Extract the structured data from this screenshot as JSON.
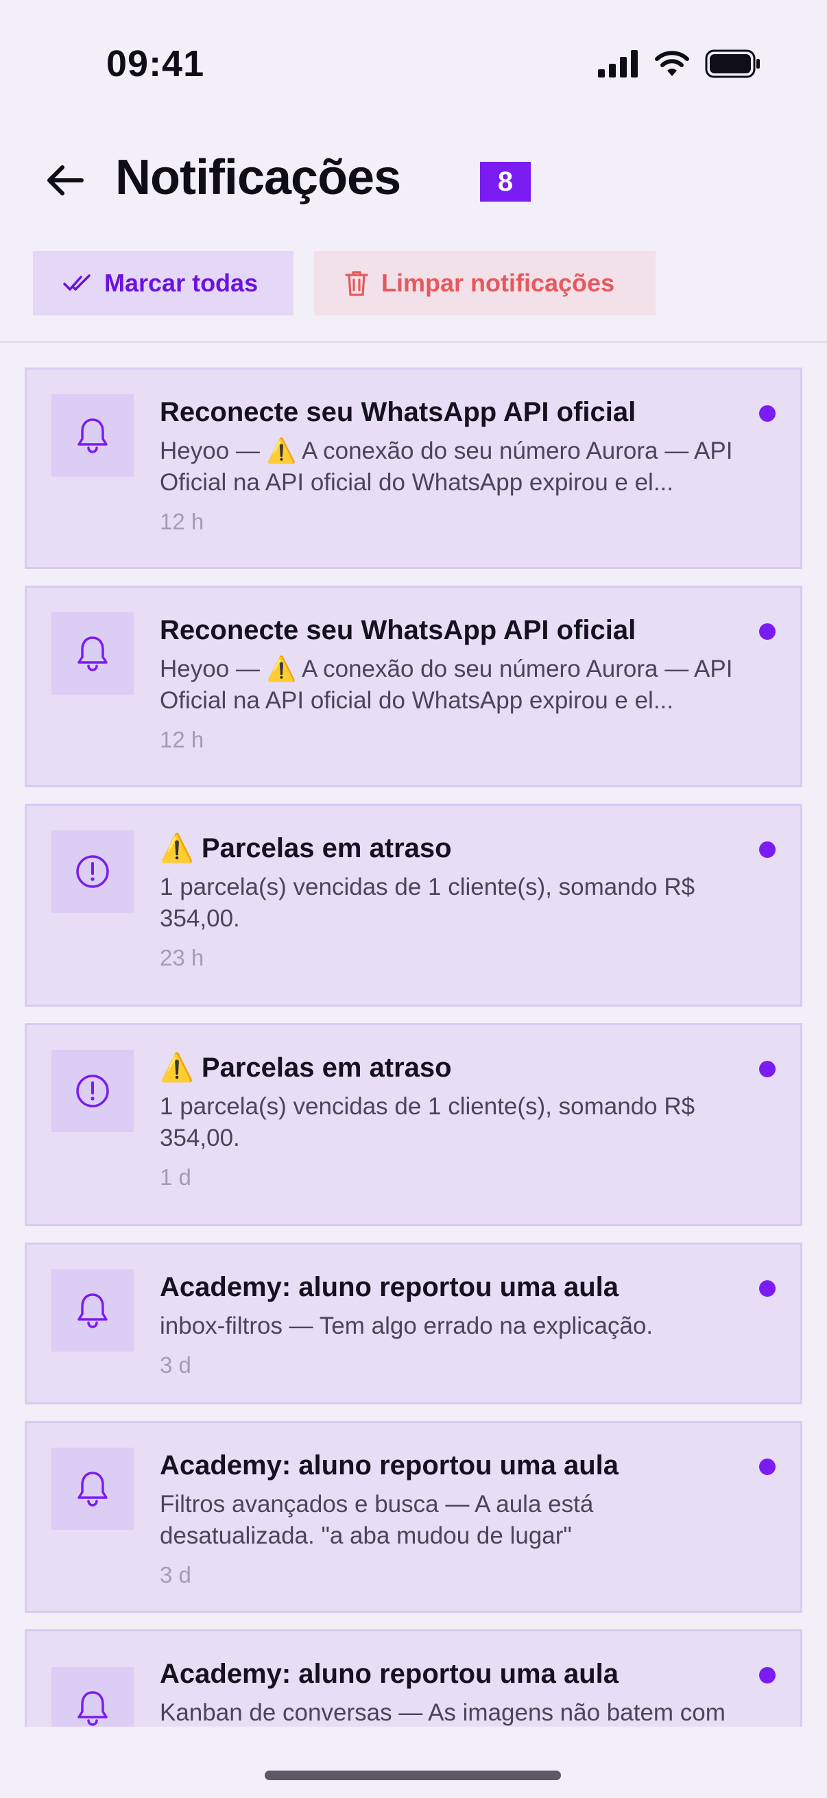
{
  "status_bar": {
    "time": "09:41"
  },
  "header": {
    "title": "Notificações",
    "count": "8"
  },
  "actions": {
    "mark_all": "Marcar todas",
    "clear": "Limpar notificações"
  },
  "colors": {
    "accent": "#7A1CF2",
    "danger": "#E6585D",
    "card_bg": "#E7DDF5"
  },
  "notifications": [
    {
      "icon": "bell-icon",
      "title": "Reconecte seu WhatsApp API oficial",
      "body": "Heyoo — ⚠️ A conexão do seu número Aurora — API Oficial na API oficial do WhatsApp expirou e el...",
      "time": "12 h",
      "unread": true
    },
    {
      "icon": "bell-icon",
      "title": "Reconecte seu WhatsApp API oficial",
      "body": "Heyoo — ⚠️ A conexão do seu número Aurora — API Oficial na API oficial do WhatsApp expirou e el...",
      "time": "12 h",
      "unread": true
    },
    {
      "icon": "alert-circle-icon",
      "title": "⚠️ Parcelas em atraso",
      "body": "1 parcela(s) vencidas de 1 cliente(s), somando R$ 354,00.",
      "time": "23 h",
      "unread": true
    },
    {
      "icon": "alert-circle-icon",
      "title": "⚠️ Parcelas em atraso",
      "body": "1 parcela(s) vencidas de 1 cliente(s), somando R$ 354,00.",
      "time": "1 d",
      "unread": true
    },
    {
      "icon": "bell-icon",
      "title": "Academy: aluno reportou uma aula",
      "body": "inbox-filtros — Tem algo errado na explicação.",
      "time": "3 d",
      "unread": true
    },
    {
      "icon": "bell-icon",
      "title": "Academy: aluno reportou uma aula",
      "body": "Filtros avançados e busca — A aula está desatualizada. \"a aba mudou de lugar\"",
      "time": "3 d",
      "unread": true
    },
    {
      "icon": "bell-icon",
      "title": "Academy: aluno reportou uma aula",
      "body": "Kanban de conversas — As imagens não batem com",
      "time": "",
      "unread": true
    }
  ]
}
